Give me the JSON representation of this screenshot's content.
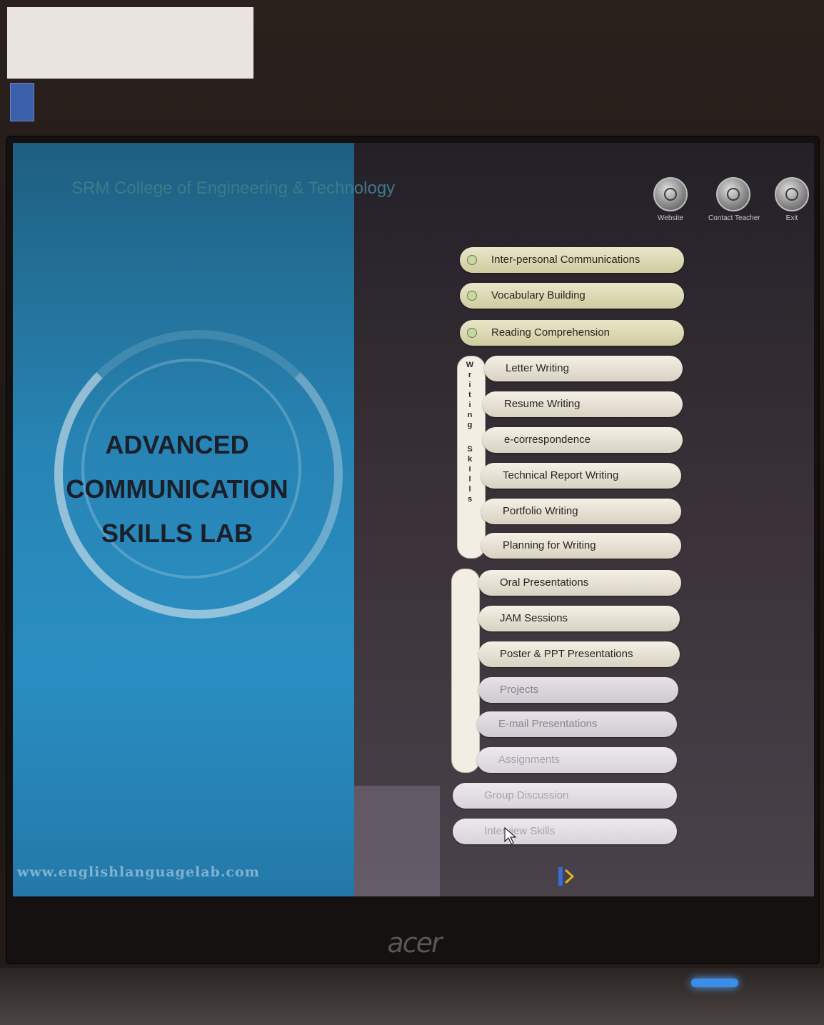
{
  "screen": {
    "college_title": "SRM College of Engineering & Technology",
    "lab_title_lines": [
      "ADVANCED",
      "COMMUNICATION",
      "SKILLS LAB"
    ],
    "website": "www.englishlanguagelab.com"
  },
  "top_buttons": [
    {
      "label": "Website",
      "icon": "power-icon"
    },
    {
      "label": "Contact Teacher",
      "icon": "power-icon"
    },
    {
      "label": "Exit",
      "icon": "power-icon"
    }
  ],
  "menu": {
    "main_items": [
      "Inter-personal Communications",
      "Vocabulary Building",
      "Reading Comprehension"
    ],
    "writing_group_label": [
      "W",
      "r",
      "i",
      "t",
      "i",
      "n",
      "g",
      "S",
      "k",
      "i",
      "l",
      "l",
      "s"
    ],
    "writing_items": [
      "Letter Writing",
      "Resume Writing",
      "e-correspondence",
      "Technical Report Writing",
      "Portfolio Writing",
      "Planning for Writing"
    ],
    "presentation_items": [
      "Oral Presentations",
      "JAM Sessions",
      "Poster & PPT Presentations",
      "Projects",
      "E-mail Presentations",
      "Assignments"
    ],
    "bottom_items": [
      "Group Discussion",
      "Interview Skills"
    ]
  },
  "device": {
    "brand": "acer"
  },
  "colors": {
    "left_panel": "#2784b4",
    "menu_pill": "#f4f0e6",
    "power_led": "#3a8ee8"
  }
}
